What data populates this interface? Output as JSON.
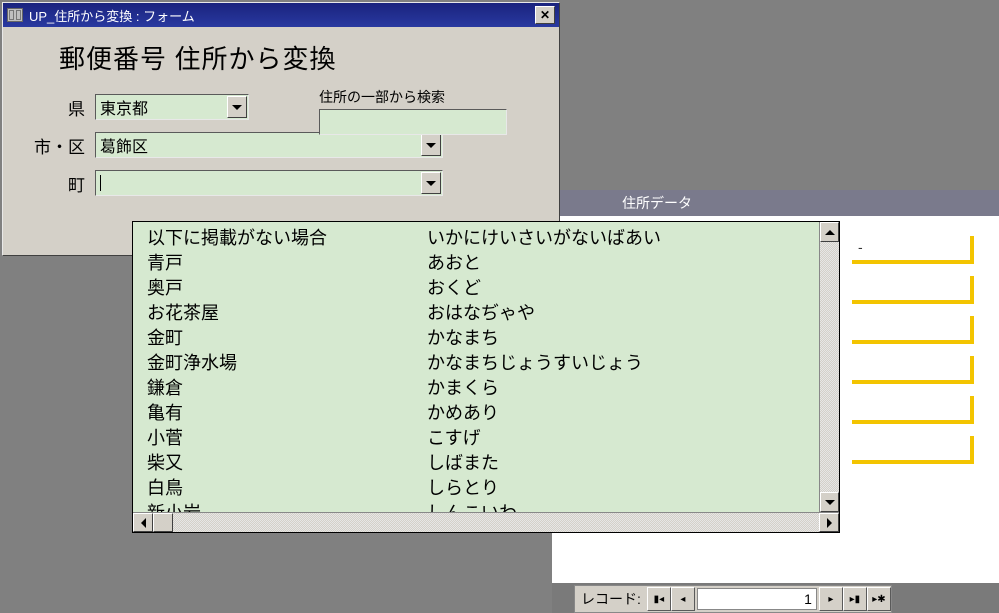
{
  "window": {
    "title": "UP_住所から変換 : フォーム",
    "heading": "郵便番号 住所から変換",
    "labels": {
      "pref": "県",
      "city": "市・区",
      "town": "町"
    },
    "values": {
      "pref": "東京都",
      "city": "葛飾区",
      "town": ""
    },
    "search_label": "住所の一部から検索"
  },
  "dropdown": {
    "col1": [
      "以下に掲載がない場合",
      "青戸",
      "奥戸",
      "お花茶屋",
      "金町",
      "金町浄水場",
      "鎌倉",
      "亀有",
      "小菅",
      "柴又",
      "白鳥",
      "新小岩"
    ],
    "col2": [
      "いかにけいさいがないばあい",
      "あおと",
      "おくど",
      "おはなぢゃや",
      "かなまち",
      "かなまちじょうすいじょう",
      "かまくら",
      "かめあり",
      "こすげ",
      "しばまた",
      "しらとり",
      "しんこいわ"
    ]
  },
  "bg_window": {
    "title": "住所データ",
    "zip_display": "   -",
    "nav": {
      "label": "レコード:",
      "current": "1"
    }
  }
}
